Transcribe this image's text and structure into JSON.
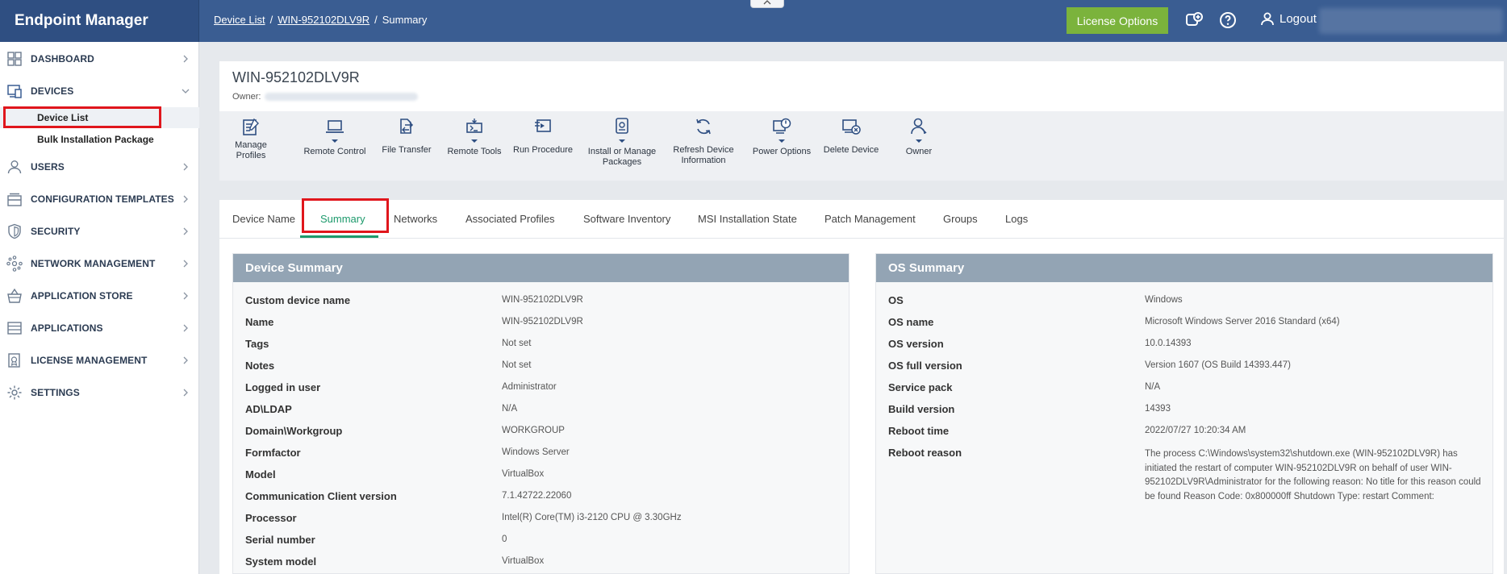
{
  "app": {
    "title": "Endpoint Manager"
  },
  "breadcrumb": {
    "device_list": "Device List",
    "device": "WIN-952102DLV9R",
    "current": "Summary",
    "sep": "/"
  },
  "topbar": {
    "license_button": "License Options",
    "logout": "Logout",
    "collapse": "^"
  },
  "sidebar": {
    "items": [
      {
        "label": "DASHBOARD",
        "icon": "grid-icon"
      },
      {
        "label": "DEVICES",
        "icon": "devices-icon"
      },
      {
        "label": "USERS",
        "icon": "user-icon"
      },
      {
        "label": "CONFIGURATION TEMPLATES",
        "icon": "templates-icon"
      },
      {
        "label": "SECURITY",
        "icon": "shield-icon"
      },
      {
        "label": "NETWORK MANAGEMENT",
        "icon": "network-icon"
      },
      {
        "label": "APPLICATION STORE",
        "icon": "basket-icon"
      },
      {
        "label": "APPLICATIONS",
        "icon": "apps-icon"
      },
      {
        "label": "LICENSE MANAGEMENT",
        "icon": "license-icon"
      },
      {
        "label": "SETTINGS",
        "icon": "gear-icon"
      }
    ],
    "sub_items": [
      "Device List",
      "Bulk Installation Package"
    ]
  },
  "device": {
    "name": "WIN-952102DLV9R",
    "owner_label": "Owner:"
  },
  "toolbar": {
    "tools": [
      {
        "label": "Manage Profiles",
        "icon": "manage-profiles-icon"
      },
      {
        "label": "Remote Control",
        "icon": "laptop-icon"
      },
      {
        "label": "File Transfer",
        "icon": "file-transfer-icon"
      },
      {
        "label": "Remote Tools",
        "icon": "remote-tools-icon"
      },
      {
        "label": "Run Procedure",
        "icon": "run-procedure-icon"
      },
      {
        "label": "Install or Manage Packages",
        "icon": "package-icon"
      },
      {
        "label": "Refresh Device Information",
        "icon": "refresh-icon"
      },
      {
        "label": "Power Options",
        "icon": "power-icon"
      },
      {
        "label": "Delete Device",
        "icon": "delete-device-icon"
      },
      {
        "label": "Owner",
        "icon": "owner-icon"
      }
    ]
  },
  "tabs": [
    "Device Name",
    "Summary",
    "Networks",
    "Associated Profiles",
    "Software Inventory",
    "MSI Installation State",
    "Patch Management",
    "Groups",
    "Logs"
  ],
  "device_summary": {
    "title": "Device Summary",
    "rows": [
      {
        "k": "Custom device name",
        "v": "WIN-952102DLV9R"
      },
      {
        "k": "Name",
        "v": "WIN-952102DLV9R"
      },
      {
        "k": "Tags",
        "v": "Not set"
      },
      {
        "k": "Notes",
        "v": "Not set"
      },
      {
        "k": "Logged in user",
        "v": "Administrator"
      },
      {
        "k": "AD\\LDAP",
        "v": "N/A"
      },
      {
        "k": "Domain\\Workgroup",
        "v": "WORKGROUP"
      },
      {
        "k": "Formfactor",
        "v": "Windows Server"
      },
      {
        "k": "Model",
        "v": "VirtualBox"
      },
      {
        "k": "Communication Client version",
        "v": "7.1.42722.22060"
      },
      {
        "k": "Processor",
        "v": "Intel(R) Core(TM) i3-2120 CPU @ 3.30GHz"
      },
      {
        "k": "Serial number",
        "v": "0"
      },
      {
        "k": "System model",
        "v": "VirtualBox"
      }
    ]
  },
  "os_summary": {
    "title": "OS Summary",
    "rows": [
      {
        "k": "OS",
        "v": "Windows"
      },
      {
        "k": "OS name",
        "v": "Microsoft Windows Server 2016 Standard (x64)"
      },
      {
        "k": "OS version",
        "v": "10.0.14393"
      },
      {
        "k": "OS full version",
        "v": "Version 1607 (OS Build 14393.447)"
      },
      {
        "k": "Service pack",
        "v": "N/A"
      },
      {
        "k": "Build version",
        "v": "14393"
      },
      {
        "k": "Reboot time",
        "v": "2022/07/27 10:20:34 AM"
      },
      {
        "k": "Reboot reason",
        "v": "The process C:\\Windows\\system32\\shutdown.exe (WIN-952102DLV9R) has initiated the restart of computer WIN-952102DLV9R on behalf of user WIN-952102DLV9R\\Administrator for the following reason: No title for this reason could be found Reason Code: 0x800000ff Shutdown Type: restart Comment:"
      }
    ]
  },
  "colors": {
    "topbar": "#3a5d92",
    "brand": "#2f4f82",
    "license_green": "#7bb33c",
    "tab_active": "#1d9a6c",
    "panel_head": "#93a4b4",
    "highlight_red": "#e0161c"
  }
}
